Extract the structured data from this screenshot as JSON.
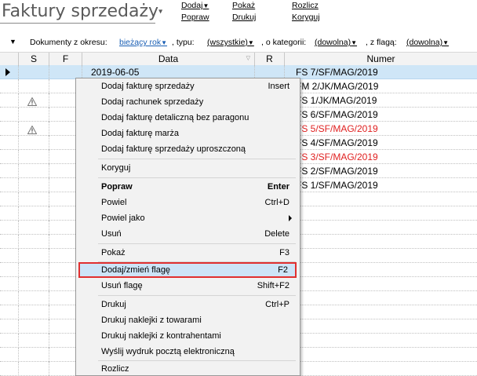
{
  "header": {
    "title": "Faktury sprzedaży",
    "links_col1": [
      "Dodaj",
      "Popraw"
    ],
    "links_col2": [
      "Pokaż",
      "Drukuj"
    ],
    "links_col3": [
      "Rozlicz",
      "Koryguj"
    ]
  },
  "filters": {
    "okres_label": "Dokumenty z okresu:",
    "okres_value": "bieżący rok",
    "typ_label": ", typu:",
    "typ_value": "(wszystkie)",
    "kategoria_label": ", o kategorii:",
    "kategoria_value": "(dowolna)",
    "flaga_label": ", z flagą:",
    "flaga_value": "(dowolna)"
  },
  "grid": {
    "columns": [
      "S",
      "F",
      "Data",
      "R",
      "Numer"
    ],
    "rows": [
      {
        "warn": false,
        "data": "2019-06-05",
        "numer": "FS 7/SF/MAG/2019",
        "red": false,
        "selected": true
      },
      {
        "warn": false,
        "data": "",
        "numer": "FM 2/JK/MAG/2019",
        "red": false,
        "selected": false
      },
      {
        "warn": true,
        "data": "",
        "numer": "FS 1/JK/MAG/2019",
        "red": false,
        "selected": false
      },
      {
        "warn": false,
        "data": "",
        "numer": "FS 6/SF/MAG/2019",
        "red": false,
        "selected": false
      },
      {
        "warn": true,
        "data": "",
        "numer": "FS 5/SF/MAG/2019",
        "red": true,
        "selected": false
      },
      {
        "warn": false,
        "data": "",
        "numer": "FS 4/SF/MAG/2019",
        "red": false,
        "selected": false
      },
      {
        "warn": false,
        "data": "",
        "numer": "FS 3/SF/MAG/2019",
        "red": true,
        "selected": false
      },
      {
        "warn": false,
        "data": "",
        "numer": "FS 2/SF/MAG/2019",
        "red": false,
        "selected": false
      },
      {
        "warn": false,
        "data": "",
        "numer": "FS 1/SF/MAG/2019",
        "red": false,
        "selected": false
      }
    ]
  },
  "context_menu": {
    "items": [
      {
        "label": "Dodaj fakturę sprzedaży",
        "shortcut": "Insert"
      },
      {
        "label": "Dodaj rachunek sprzedaży",
        "shortcut": ""
      },
      {
        "label": "Dodaj fakturę detaliczną bez paragonu",
        "shortcut": ""
      },
      {
        "label": "Dodaj fakturę marża",
        "shortcut": ""
      },
      {
        "label": "Dodaj fakturę sprzedaży uproszczoną",
        "shortcut": ""
      },
      {
        "label": "Koryguj",
        "shortcut": ""
      },
      {
        "label": "Popraw",
        "shortcut": "Enter"
      },
      {
        "label": "Powiel",
        "shortcut": "Ctrl+D"
      },
      {
        "label": "Powiel jako",
        "shortcut": ""
      },
      {
        "label": "Usuń",
        "shortcut": "Delete"
      },
      {
        "label": "Pokaż",
        "shortcut": "F3"
      },
      {
        "label": "Dodaj/zmień flagę",
        "shortcut": "F2"
      },
      {
        "label": "Usuń flagę",
        "shortcut": "Shift+F2"
      },
      {
        "label": "Drukuj",
        "shortcut": "Ctrl+P"
      },
      {
        "label": "Drukuj naklejki z towarami",
        "shortcut": ""
      },
      {
        "label": "Drukuj naklejki z kontrahentami",
        "shortcut": ""
      },
      {
        "label": "Wyślij wydruk pocztą elektroniczną",
        "shortcut": ""
      },
      {
        "label": "Rozlicz",
        "shortcut": ""
      }
    ]
  },
  "colors": {
    "selection": "#cfe6f7",
    "highlight_border": "#e03030",
    "red_text": "#e02020",
    "link_blue": "#1a5fb4"
  }
}
